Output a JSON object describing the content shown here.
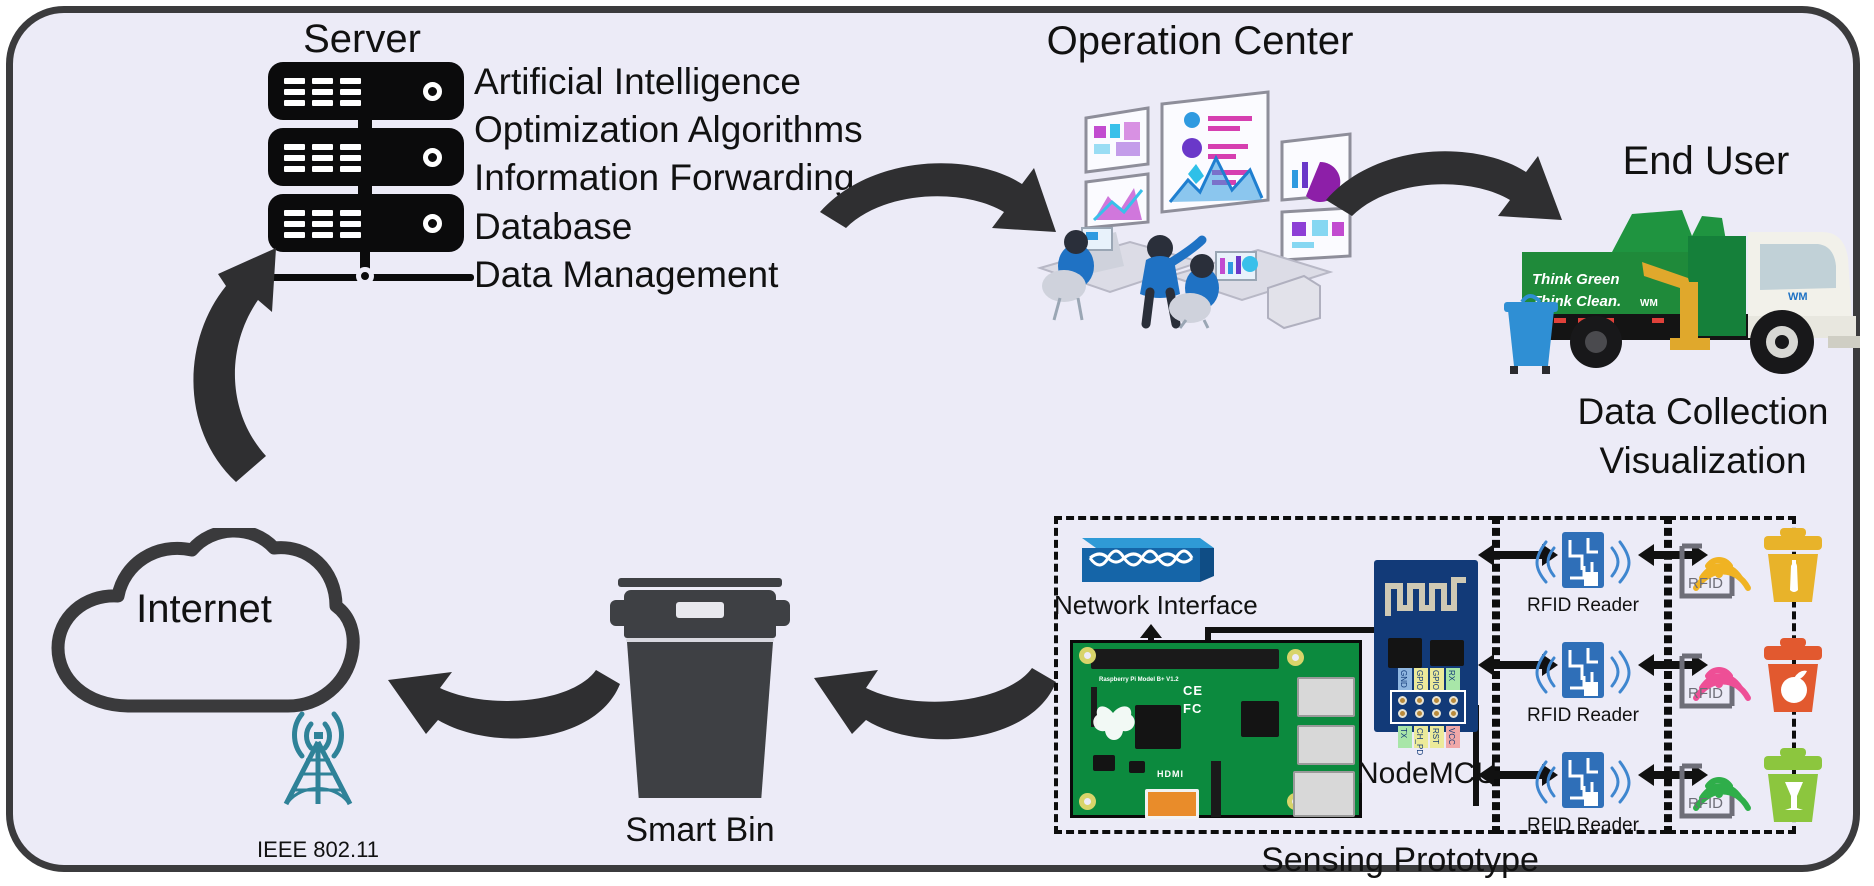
{
  "diagram": {
    "title_nodes": {
      "server": "Server",
      "operation_center": "Operation Center",
      "end_user": "End User",
      "internet": "Internet",
      "smart_bin": "Smart Bin",
      "sensing_prototype": "Sensing Prototype"
    },
    "server_functions": [
      "Artificial Intelligence",
      "Optimization Algorithms",
      "Information Forwarding",
      "Database",
      "Data Management"
    ],
    "end_user_functions": [
      "Data Collection",
      "Visualization"
    ],
    "wireless_standard": "IEEE 802.11",
    "network_interface_label": "Network Interface",
    "nodemcu_label": "NodeMCU",
    "nodemcu_pins_top": [
      "GND",
      "GPIO2",
      "GPIO0",
      "RX"
    ],
    "nodemcu_pins_bottom": [
      "TX",
      "CH_PD",
      "RST",
      "VCC"
    ],
    "rfid_readers": [
      "RFID Reader",
      "RFID Reader",
      "RFID Reader"
    ],
    "rfid_tags": [
      "RFID",
      "RFID",
      "RFID"
    ],
    "pi_board_marks": [
      "HDMI",
      "CE",
      "FC"
    ],
    "truck_livery": {
      "line1": "Think Green",
      "line2": "Think Clean."
    },
    "waste_streams": [
      {
        "name": "plastic-bottle-bin",
        "color": "#e8b32a",
        "tag_color": "#f0b323"
      },
      {
        "name": "organic-waste-bin",
        "color": "#e2592f",
        "tag_color": "#ee4f96"
      },
      {
        "name": "glass-waste-bin",
        "color": "#8cc63e",
        "tag_color": "#2fae4a"
      }
    ],
    "colors": {
      "frame_border": "#3b3b3d",
      "canvas_background": "#ecebf7",
      "arrow": "#2f2f31",
      "server_body": "#0b0b0c",
      "bin_body": "#3e4044",
      "antenna": "#2f8298",
      "pi_green": "#0c8a3e",
      "nodemcu_blue": "#123a78",
      "switch_blue": "#1565a8",
      "truck_green": "#1f8a3a",
      "operator_blue": "#1f72c4"
    }
  }
}
